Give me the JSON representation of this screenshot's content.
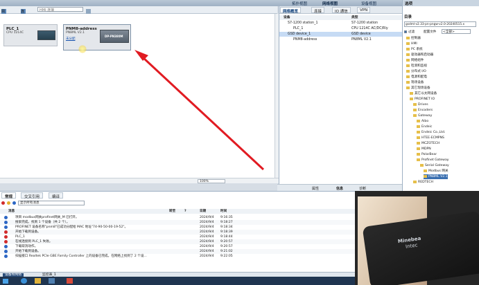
{
  "top_tabs": {
    "topology": "拓扑视图",
    "network": "网络视图",
    "device": "设备视图",
    "options": "选项"
  },
  "toolbar": {
    "network_btn": "网络",
    "connection_btn": "连接",
    "connection_type": "HMI 连接",
    "zoom": "100%"
  },
  "devices": [
    {
      "name": "PLC_1",
      "sub": "CPU 1214C"
    },
    {
      "name": "PNM8-address",
      "sub": "PN8ML V2.1",
      "link": "未分配",
      "chip": "DP-PN380M"
    }
  ],
  "overview": {
    "tabs": [
      "网络概览",
      "连接",
      "IO 通信",
      "VPN"
    ],
    "col_device": "设备",
    "col_type": "类型",
    "rows": [
      {
        "name": "S7-1200 station_1",
        "type": "S7-1200 station"
      },
      {
        "name": "PLC_1",
        "type": "CPU 1214C AC/DC/Rly"
      },
      {
        "name": "GSD device_1",
        "type": "GSD device"
      },
      {
        "name": "PNM8-address",
        "type": "PN8ML V2.1"
      }
    ]
  },
  "status_tabs": {
    "properties": "属性",
    "info": "信息",
    "diagnostics": "诊断"
  },
  "catalog": {
    "header": "目录",
    "search": "gsdml-v2.33-pn-pngw-v2.0-20240515.x",
    "filter": "过滤",
    "profile_label": "配置文件",
    "profile_value": "<全部>",
    "items": [
      {
        "label": "控制器",
        "indent": 1
      },
      {
        "label": "HMI",
        "indent": 1
      },
      {
        "label": "PC 系统",
        "indent": 1
      },
      {
        "label": "驱动器和启动器",
        "indent": 1
      },
      {
        "label": "网络组件",
        "indent": 1
      },
      {
        "label": "检测和监视",
        "indent": 1
      },
      {
        "label": "分布式 I/O",
        "indent": 1
      },
      {
        "label": "电源和配电",
        "indent": 1
      },
      {
        "label": "现场设备",
        "indent": 1
      },
      {
        "label": "其它现场设备",
        "indent": 1
      },
      {
        "label": "其它以太网设备",
        "indent": 2
      },
      {
        "label": "PROFINET IO",
        "indent": 2
      },
      {
        "label": "Drives",
        "indent": 3
      },
      {
        "label": "Encoders",
        "indent": 3
      },
      {
        "label": "Gateway",
        "indent": 3
      },
      {
        "label": "Aibo",
        "indent": 4
      },
      {
        "label": "Endeic",
        "indent": 4
      },
      {
        "label": "Endeic Co.,Ltd.",
        "indent": 4
      },
      {
        "label": "HTEE-ECMPNS",
        "indent": 4
      },
      {
        "label": "MCZOTECH",
        "indent": 4
      },
      {
        "label": "MDPN",
        "indent": 4
      },
      {
        "label": "PolarBear",
        "indent": 4
      },
      {
        "label": "Profinet Gateway",
        "indent": 4
      },
      {
        "label": "Serial Gateway",
        "indent": 5
      },
      {
        "label": "Modbus 网关",
        "indent": 6
      },
      {
        "label": "PN8ML V2.1",
        "indent": 6,
        "selected": true
      },
      {
        "label": "REDTECH",
        "indent": 3
      }
    ]
  },
  "inspector": {
    "tabs": [
      "常规",
      "交叉引用",
      "编译"
    ],
    "filter_value": "显示所有消息",
    "col_msg": "消息",
    "col_goto": "转至",
    "col_q": "?",
    "col_date": "日期",
    "col_time": "时间",
    "messages": [
      {
        "text": "项目 modbus网关profinet网关_M 已打开。",
        "date": "2024/9/4",
        "time": "9:16:35",
        "kind": "info"
      },
      {
        "text": "搜索完成。找到 1 个设备（共 2 个）。",
        "date": "2024/9/4",
        "time": "9:18:27",
        "kind": "info"
      },
      {
        "text": "PROFINET 设备名称\"pnm8\"已成功分配给 MAC 地址\"74-90-50-00-19-52\"。",
        "date": "2024/9/4",
        "time": "9:18:34",
        "kind": "ok"
      },
      {
        "text": "开始下载到设备。",
        "date": "2024/9/4",
        "time": "9:18:39",
        "kind": "err"
      },
      {
        "text": "PLC_1",
        "date": "2024/9/4",
        "time": "9:18:44",
        "kind": "err"
      },
      {
        "text": "在线连接到 PLC_1 失败。",
        "date": "2024/9/4",
        "time": "9:20:57",
        "kind": "err"
      },
      {
        "text": "下载取消动作。",
        "date": "2024/9/4",
        "time": "9:20:57",
        "kind": "info"
      },
      {
        "text": "开始下载到设备。",
        "date": "2024/9/4",
        "time": "9:21:02",
        "kind": "ok"
      },
      {
        "text": "扫描接口 Realtek PCIe GBE Family Controller 上的设备已完成。在网络上找到了 2 个设...",
        "date": "2024/9/4",
        "time": "9:22:05",
        "kind": "info"
      }
    ]
  },
  "taskbar": {
    "tab1": "设备和网络",
    "tab2": "监控表_1"
  },
  "video": {
    "brand_line1": "Minebea",
    "brand_line2": "Intec"
  }
}
